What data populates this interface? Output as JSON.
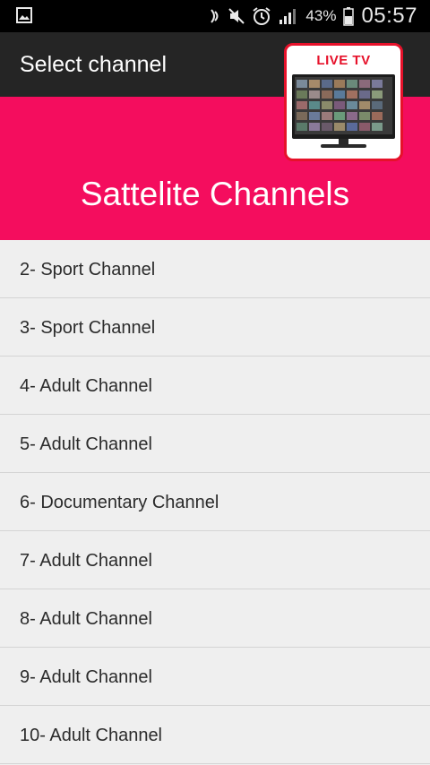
{
  "status_bar": {
    "battery_percent": "43%",
    "time": "05:57",
    "icons": [
      "gallery-icon",
      "nfc-icon",
      "mute-icon",
      "alarm-icon",
      "signal-icon",
      "battery-icon"
    ]
  },
  "app_bar": {
    "title": "Select channel"
  },
  "logo": {
    "text": "LIVE TV",
    "border_color": "#e6112a"
  },
  "banner": {
    "title": "Sattelite Channels",
    "background_color": "#f40d5e"
  },
  "channels": [
    "2- Sport Channel",
    "3- Sport Channel",
    "4- Adult Channel",
    "5- Adult Channel",
    "6- Documentary Channel",
    "7- Adult Channel",
    "8- Adult Channel",
    "9- Adult Channel",
    "10- Adult Channel"
  ]
}
